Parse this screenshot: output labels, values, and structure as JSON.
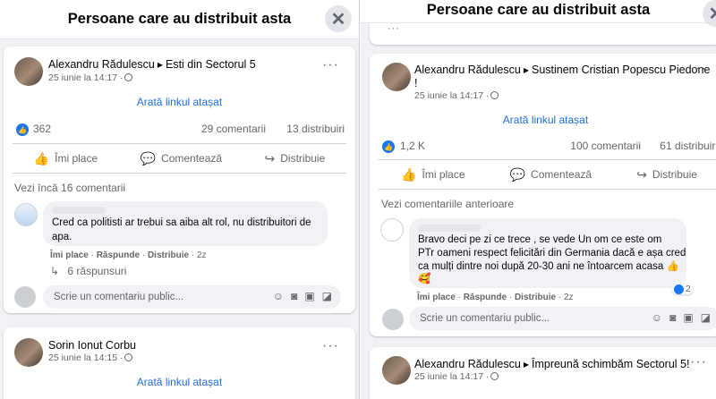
{
  "left": {
    "title": "Persoane care au distribuit asta",
    "close_glyph": "✕",
    "post1": {
      "author": "Alexandru Rădulescu",
      "target": "Esti din Sectorul 5",
      "time": "25 iunie la 14:17 ·",
      "link_label": "Arată linkul atașat",
      "likes": "362",
      "comments": "29 comentarii",
      "shares": "13 distribuiri",
      "actions": {
        "like": "Îmi place",
        "comment": "Comentează",
        "share": "Distribuie"
      },
      "more_comments": "Vezi încă 16 comentarii",
      "comment_text_1": "Cred ca politisti ar trebui sa aiba alt rol, nu distribuitori de",
      "comment_text_2": "apa.",
      "comment_actions": {
        "like": "Îmi place",
        "reply": "Răspunde",
        "share": "Distribuie",
        "age": "2z"
      },
      "replies": "6 răspunsuri",
      "write_placeholder": "Scrie un comentariu public..."
    },
    "post2": {
      "author": "Sorin Ionut Corbu",
      "time": "25 iunie la 14:15 ·",
      "link_label": "Arată linkul atașat"
    }
  },
  "right": {
    "title": "Persoane care au distribuit asta",
    "post1": {
      "author": "Alexandru Rădulescu",
      "target": "Sustinem Cristian Popescu Piedone",
      "target_cont": "!",
      "time": "25 iunie la 14:17 ·",
      "link_label": "Arată linkul atașat",
      "likes": "1,2 K",
      "comments": "100 comentarii",
      "shares": "61 distribuiri",
      "actions": {
        "like": "Îmi place",
        "comment": "Comentează",
        "share": "Distribuie"
      },
      "previous_comments": "Vezi comentariile anterioare",
      "comment_lines": [
        "Bravo deci pe zi ce trece , se vede Un om ce este om",
        "PTr oameni respect felicitări din Germania dacă e așa cred",
        "ca mulți dintre noi după 20-30 ani ne întoarcem acasa 👍",
        "🥰"
      ],
      "comment_actions": {
        "like": "Îmi place",
        "reply": "Răspunde",
        "share": "Distribuie",
        "age": "2z"
      },
      "reaction_count": "2",
      "write_placeholder": "Scrie un comentariu public..."
    },
    "post2": {
      "author": "Alexandru Rădulescu",
      "target": "Împreună schimbăm Sectorul 5!",
      "time": "25 iunie la 14:17 ·"
    }
  },
  "icons": {
    "more": "···",
    "like": "👍",
    "comment": "💬",
    "share": "↪",
    "reply_arrow": "↳"
  }
}
